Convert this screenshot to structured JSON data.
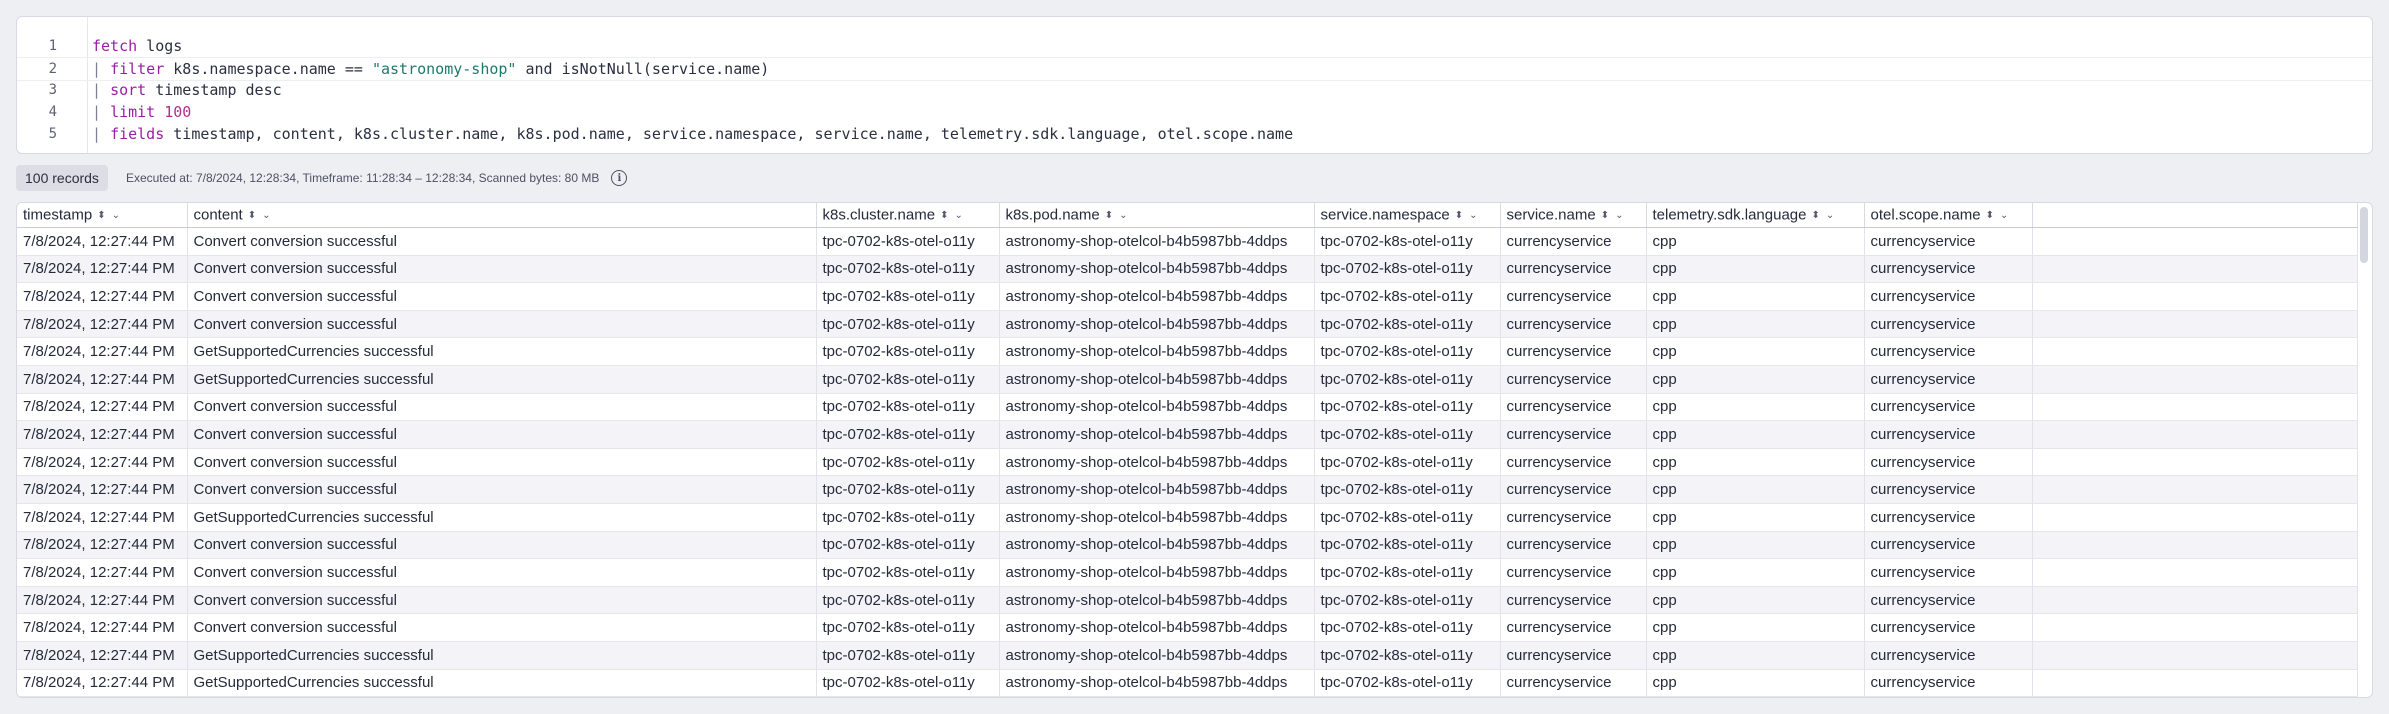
{
  "query": {
    "lines": [
      {
        "num": "1",
        "parts": [
          {
            "t": "fetch",
            "c": "kw"
          },
          {
            "t": " logs",
            "c": ""
          }
        ]
      },
      {
        "num": "2",
        "parts": [
          {
            "t": "| ",
            "c": "pipe"
          },
          {
            "t": "filter",
            "c": "kw"
          },
          {
            "t": " k8s.namespace.name == ",
            "c": ""
          },
          {
            "t": "\"astronomy-shop\"",
            "c": "str"
          },
          {
            "t": " and isNotNull(service.name)",
            "c": ""
          }
        ]
      },
      {
        "num": "3",
        "parts": [
          {
            "t": "| ",
            "c": "pipe"
          },
          {
            "t": "sort",
            "c": "kw"
          },
          {
            "t": " timestamp desc",
            "c": ""
          }
        ]
      },
      {
        "num": "4",
        "parts": [
          {
            "t": "| ",
            "c": "pipe"
          },
          {
            "t": "limit",
            "c": "kw"
          },
          {
            "t": " ",
            "c": ""
          },
          {
            "t": "100",
            "c": "num"
          }
        ]
      },
      {
        "num": "5",
        "parts": [
          {
            "t": "| ",
            "c": "pipe"
          },
          {
            "t": "fields",
            "c": "kw"
          },
          {
            "t": " timestamp, content, k8s.cluster.name, k8s.pod.name, service.namespace, service.name, telemetry.sdk.language, otel.scope.name",
            "c": ""
          }
        ]
      }
    ]
  },
  "status": {
    "records": "100 records",
    "executed": "Executed at: 7/8/2024, 12:28:34, Timeframe: 11:28:34 – 12:28:34, Scanned bytes: 80 MB",
    "info_icon": "info-icon"
  },
  "table": {
    "columns": [
      "timestamp",
      "content",
      "k8s.cluster.name",
      "k8s.pod.name",
      "service.namespace",
      "service.name",
      "telemetry.sdk.language",
      "otel.scope.name"
    ],
    "rows": [
      [
        "7/8/2024, 12:27:44 PM",
        "Convert conversion successful",
        "tpc-0702-k8s-otel-o11y",
        "astronomy-shop-otelcol-b4b5987bb-4ddps",
        "tpc-0702-k8s-otel-o11y",
        "currencyservice",
        "cpp",
        "currencyservice"
      ],
      [
        "7/8/2024, 12:27:44 PM",
        "Convert conversion successful",
        "tpc-0702-k8s-otel-o11y",
        "astronomy-shop-otelcol-b4b5987bb-4ddps",
        "tpc-0702-k8s-otel-o11y",
        "currencyservice",
        "cpp",
        "currencyservice"
      ],
      [
        "7/8/2024, 12:27:44 PM",
        "Convert conversion successful",
        "tpc-0702-k8s-otel-o11y",
        "astronomy-shop-otelcol-b4b5987bb-4ddps",
        "tpc-0702-k8s-otel-o11y",
        "currencyservice",
        "cpp",
        "currencyservice"
      ],
      [
        "7/8/2024, 12:27:44 PM",
        "Convert conversion successful",
        "tpc-0702-k8s-otel-o11y",
        "astronomy-shop-otelcol-b4b5987bb-4ddps",
        "tpc-0702-k8s-otel-o11y",
        "currencyservice",
        "cpp",
        "currencyservice"
      ],
      [
        "7/8/2024, 12:27:44 PM",
        "GetSupportedCurrencies successful",
        "tpc-0702-k8s-otel-o11y",
        "astronomy-shop-otelcol-b4b5987bb-4ddps",
        "tpc-0702-k8s-otel-o11y",
        "currencyservice",
        "cpp",
        "currencyservice"
      ],
      [
        "7/8/2024, 12:27:44 PM",
        "GetSupportedCurrencies successful",
        "tpc-0702-k8s-otel-o11y",
        "astronomy-shop-otelcol-b4b5987bb-4ddps",
        "tpc-0702-k8s-otel-o11y",
        "currencyservice",
        "cpp",
        "currencyservice"
      ],
      [
        "7/8/2024, 12:27:44 PM",
        "Convert conversion successful",
        "tpc-0702-k8s-otel-o11y",
        "astronomy-shop-otelcol-b4b5987bb-4ddps",
        "tpc-0702-k8s-otel-o11y",
        "currencyservice",
        "cpp",
        "currencyservice"
      ],
      [
        "7/8/2024, 12:27:44 PM",
        "Convert conversion successful",
        "tpc-0702-k8s-otel-o11y",
        "astronomy-shop-otelcol-b4b5987bb-4ddps",
        "tpc-0702-k8s-otel-o11y",
        "currencyservice",
        "cpp",
        "currencyservice"
      ],
      [
        "7/8/2024, 12:27:44 PM",
        "Convert conversion successful",
        "tpc-0702-k8s-otel-o11y",
        "astronomy-shop-otelcol-b4b5987bb-4ddps",
        "tpc-0702-k8s-otel-o11y",
        "currencyservice",
        "cpp",
        "currencyservice"
      ],
      [
        "7/8/2024, 12:27:44 PM",
        "Convert conversion successful",
        "tpc-0702-k8s-otel-o11y",
        "astronomy-shop-otelcol-b4b5987bb-4ddps",
        "tpc-0702-k8s-otel-o11y",
        "currencyservice",
        "cpp",
        "currencyservice"
      ],
      [
        "7/8/2024, 12:27:44 PM",
        "GetSupportedCurrencies successful",
        "tpc-0702-k8s-otel-o11y",
        "astronomy-shop-otelcol-b4b5987bb-4ddps",
        "tpc-0702-k8s-otel-o11y",
        "currencyservice",
        "cpp",
        "currencyservice"
      ],
      [
        "7/8/2024, 12:27:44 PM",
        "Convert conversion successful",
        "tpc-0702-k8s-otel-o11y",
        "astronomy-shop-otelcol-b4b5987bb-4ddps",
        "tpc-0702-k8s-otel-o11y",
        "currencyservice",
        "cpp",
        "currencyservice"
      ],
      [
        "7/8/2024, 12:27:44 PM",
        "Convert conversion successful",
        "tpc-0702-k8s-otel-o11y",
        "astronomy-shop-otelcol-b4b5987bb-4ddps",
        "tpc-0702-k8s-otel-o11y",
        "currencyservice",
        "cpp",
        "currencyservice"
      ],
      [
        "7/8/2024, 12:27:44 PM",
        "Convert conversion successful",
        "tpc-0702-k8s-otel-o11y",
        "astronomy-shop-otelcol-b4b5987bb-4ddps",
        "tpc-0702-k8s-otel-o11y",
        "currencyservice",
        "cpp",
        "currencyservice"
      ],
      [
        "7/8/2024, 12:27:44 PM",
        "Convert conversion successful",
        "tpc-0702-k8s-otel-o11y",
        "astronomy-shop-otelcol-b4b5987bb-4ddps",
        "tpc-0702-k8s-otel-o11y",
        "currencyservice",
        "cpp",
        "currencyservice"
      ],
      [
        "7/8/2024, 12:27:44 PM",
        "GetSupportedCurrencies successful",
        "tpc-0702-k8s-otel-o11y",
        "astronomy-shop-otelcol-b4b5987bb-4ddps",
        "tpc-0702-k8s-otel-o11y",
        "currencyservice",
        "cpp",
        "currencyservice"
      ],
      [
        "7/8/2024, 12:27:44 PM",
        "GetSupportedCurrencies successful",
        "tpc-0702-k8s-otel-o11y",
        "astronomy-shop-otelcol-b4b5987bb-4ddps",
        "tpc-0702-k8s-otel-o11y",
        "currencyservice",
        "cpp",
        "currencyservice"
      ]
    ]
  }
}
